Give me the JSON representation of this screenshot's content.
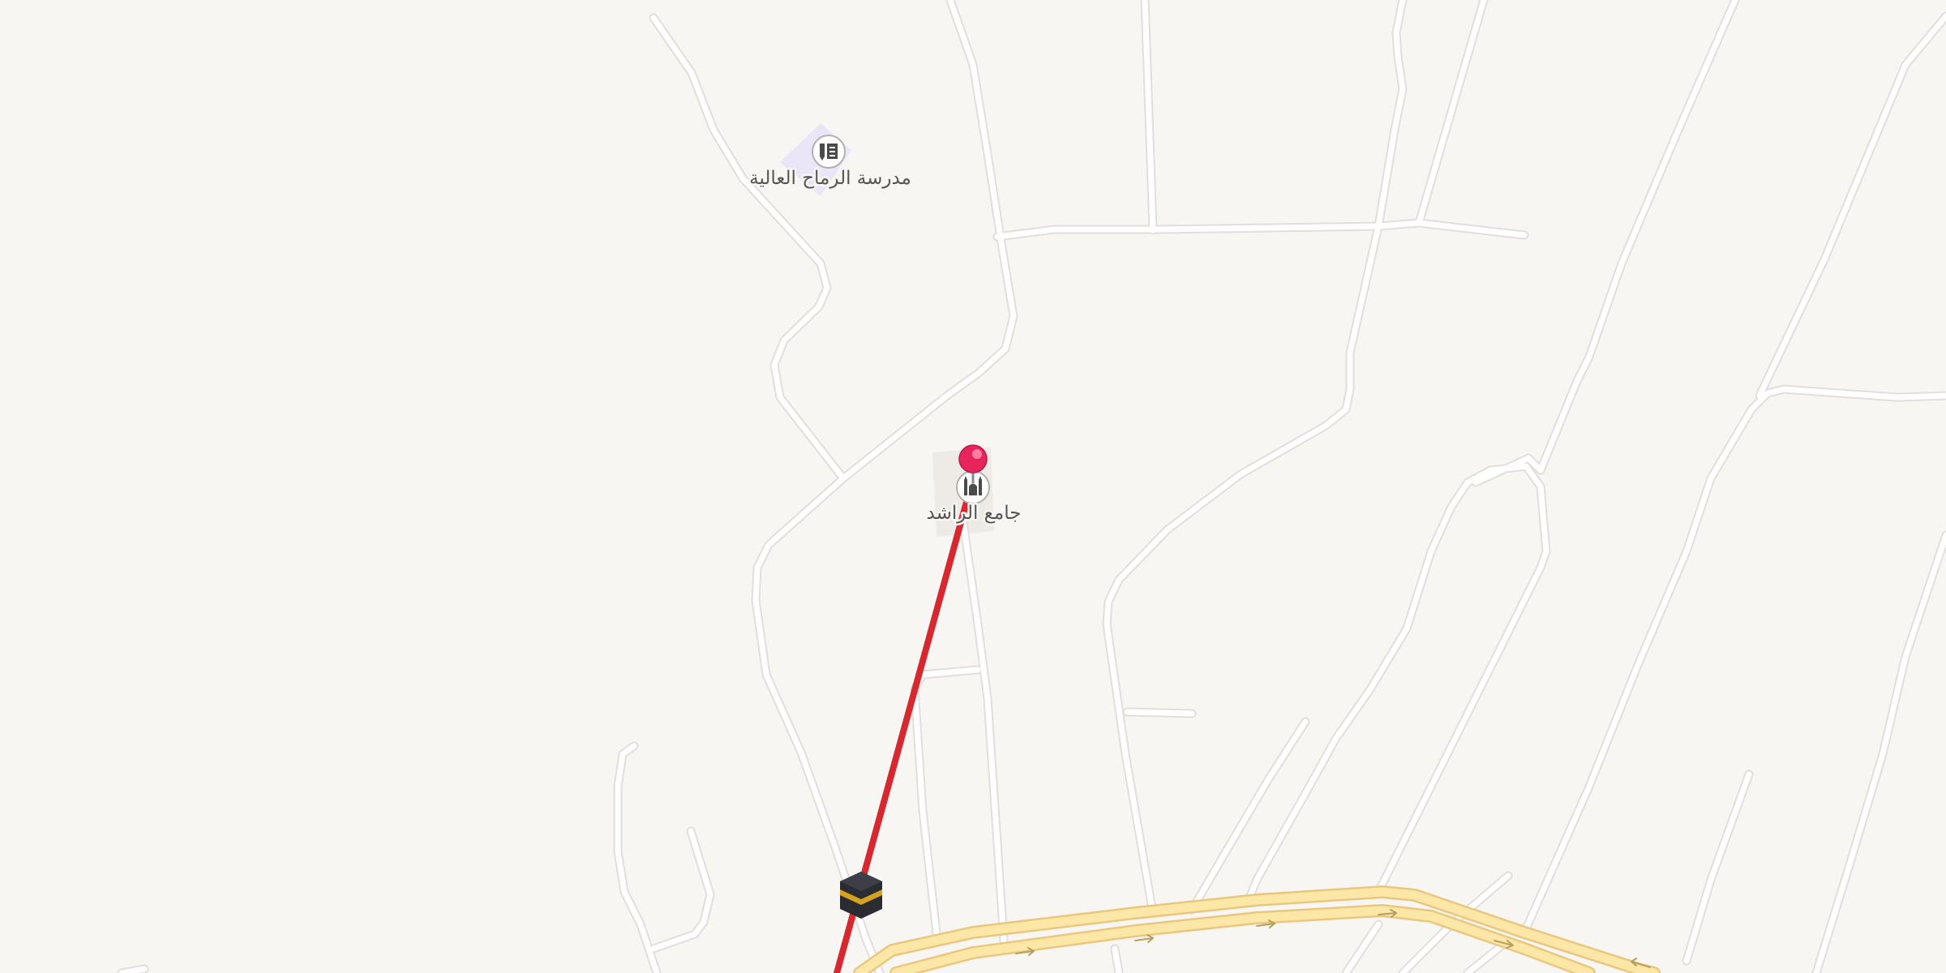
{
  "map": {
    "background_color": "#f8f6f3",
    "road_color": "#ffffff",
    "road_casing_color": "#e2dedb",
    "main_road_color": "#fde7a6",
    "main_road_casing_color": "#e9c77f",
    "route_line_color": "#d7282f",
    "pin_color": "#e8245c"
  },
  "pois": [
    {
      "id": "school",
      "name": "مدرسة الرماح العالية",
      "icon": "school-icon"
    },
    {
      "id": "mosque",
      "name": "جامع الراشد",
      "icon": "mosque-icon"
    }
  ],
  "markers": {
    "destination_pin": "map-pin-icon",
    "origin_marker": "kaaba-icon"
  },
  "oneway_arrows": [
    "→",
    "→",
    "→",
    "→",
    "→",
    "←"
  ]
}
